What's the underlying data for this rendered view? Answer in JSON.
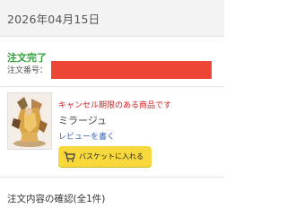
{
  "header": {
    "date": "2026年04月15日"
  },
  "order": {
    "status": "注文完了",
    "number_label": "注文番号："
  },
  "item": {
    "notice": "キャンセル期限のある商品です",
    "name": "ミラージュ",
    "review_link": "レビューを書く",
    "cart_button_label": "バスケットに入れる",
    "cart_icon": "basket-icon"
  },
  "section": {
    "title": "注文内容の確認(全1件)"
  },
  "colors": {
    "status_green": "#2e9f37",
    "notice_red": "#d32121",
    "link_blue": "#3a66b0",
    "button_yellow": "#f8d83a",
    "redaction_red": "#ef4535"
  }
}
